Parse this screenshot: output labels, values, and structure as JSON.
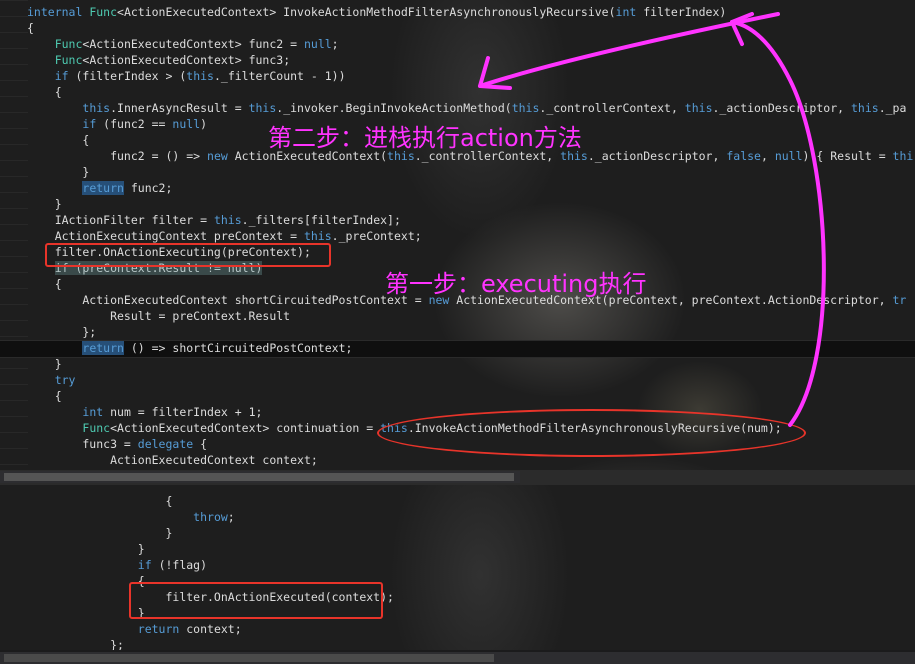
{
  "code_top": [
    [
      {
        "t": "internal ",
        "c": "kw"
      },
      {
        "t": "Func",
        "c": "ty"
      },
      {
        "t": "<ActionExecutedContext> InvokeActionMethodFilterAsynchronouslyRecursive("
      },
      {
        "t": "int",
        "c": "kw"
      },
      {
        "t": " filterIndex)"
      }
    ],
    [
      {
        "t": "{"
      }
    ],
    [
      {
        "t": "    "
      },
      {
        "t": "Func",
        "c": "ty"
      },
      {
        "t": "<ActionExecutedContext> func2 = "
      },
      {
        "t": "null",
        "c": "kw"
      },
      {
        "t": ";"
      }
    ],
    [
      {
        "t": "    "
      },
      {
        "t": "Func",
        "c": "ty"
      },
      {
        "t": "<ActionExecutedContext> func3;"
      }
    ],
    [
      {
        "t": "    "
      },
      {
        "t": "if",
        "c": "kw"
      },
      {
        "t": " (filterIndex > ("
      },
      {
        "t": "this",
        "c": "kw"
      },
      {
        "t": "._filterCount - 1))"
      }
    ],
    [
      {
        "t": "    {"
      }
    ],
    [
      {
        "t": "        "
      },
      {
        "t": "this",
        "c": "kw"
      },
      {
        "t": ".InnerAsyncResult = "
      },
      {
        "t": "this",
        "c": "kw"
      },
      {
        "t": "._invoker.BeginInvokeActionMethod("
      },
      {
        "t": "this",
        "c": "kw"
      },
      {
        "t": "._controllerContext, "
      },
      {
        "t": "this",
        "c": "kw"
      },
      {
        "t": "._actionDescriptor, "
      },
      {
        "t": "this",
        "c": "kw"
      },
      {
        "t": "._pa"
      }
    ],
    [
      {
        "t": "        "
      },
      {
        "t": "if",
        "c": "kw"
      },
      {
        "t": " (func2 == "
      },
      {
        "t": "null",
        "c": "kw"
      },
      {
        "t": ")"
      }
    ],
    [
      {
        "t": "        {"
      }
    ],
    [
      {
        "t": "            func2 = () => "
      },
      {
        "t": "new",
        "c": "kw"
      },
      {
        "t": " ActionExecutedContext("
      },
      {
        "t": "this",
        "c": "kw"
      },
      {
        "t": "._controllerContext, "
      },
      {
        "t": "this",
        "c": "kw"
      },
      {
        "t": "._actionDescriptor, "
      },
      {
        "t": "false",
        "c": "kw"
      },
      {
        "t": ", "
      },
      {
        "t": "null",
        "c": "kw"
      },
      {
        "t": ") { Result = "
      },
      {
        "t": "thi",
        "c": "kw"
      }
    ],
    [
      {
        "t": "        }"
      }
    ],
    [
      {
        "t": "        "
      },
      {
        "t": "return",
        "c": "kw hsel"
      },
      {
        "t": " func2;"
      }
    ],
    [
      {
        "t": "    }"
      }
    ],
    [
      {
        "t": "    IActionFilter filter = "
      },
      {
        "t": "this",
        "c": "kw"
      },
      {
        "t": "._filters[filterIndex];"
      }
    ],
    [
      {
        "t": "    ActionExecutingContext preContext = "
      },
      {
        "t": "this",
        "c": "kw"
      },
      {
        "t": "._preContext;"
      }
    ],
    [
      {
        "t": "    filter.OnActionExecuting(preContext);"
      }
    ],
    [
      {
        "t": "    "
      },
      {
        "t": "if (preContext.Result != null)",
        "c": "hgrey"
      }
    ],
    [
      {
        "t": "    {"
      }
    ],
    [
      {
        "t": "        ActionExecutedContext shortCircuitedPostContext = "
      },
      {
        "t": "new",
        "c": "kw"
      },
      {
        "t": " ActionExecutedContext(preContext, preContext.ActionDescriptor, "
      },
      {
        "t": "tr",
        "c": "kw"
      }
    ],
    [
      {
        "t": "            Result = preContext.Result"
      }
    ],
    [
      {
        "t": "        };"
      }
    ],
    [
      {
        "t": "        "
      },
      {
        "t": "return",
        "c": "kw hsel"
      },
      {
        "t": " () => shortCircuitedPostContext;"
      }
    ],
    [
      {
        "t": "    }"
      }
    ],
    [
      {
        "t": "    "
      },
      {
        "t": "try",
        "c": "kw"
      }
    ],
    [
      {
        "t": "    {"
      }
    ],
    [
      {
        "t": "        "
      },
      {
        "t": "int",
        "c": "kw"
      },
      {
        "t": " num = filterIndex + 1;"
      }
    ],
    [
      {
        "t": "        "
      },
      {
        "t": "Func",
        "c": "ty"
      },
      {
        "t": "<ActionExecutedContext> continuation = "
      },
      {
        "t": "this",
        "c": "kw"
      },
      {
        "t": ".InvokeActionMethodFilterAsynchronouslyRecursive(num);"
      }
    ],
    [
      {
        "t": "        func3 = "
      },
      {
        "t": "delegate",
        "c": "kw"
      },
      {
        "t": " {"
      }
    ],
    [
      {
        "t": "            ActionExecutedContext context;"
      }
    ]
  ],
  "code_bottom": [
    [
      {
        "t": "                    {"
      }
    ],
    [
      {
        "t": "                        "
      },
      {
        "t": "throw",
        "c": "kw"
      },
      {
        "t": ";"
      }
    ],
    [
      {
        "t": "                    }"
      }
    ],
    [
      {
        "t": "                }"
      }
    ],
    [
      {
        "t": "                "
      },
      {
        "t": "if",
        "c": "kw"
      },
      {
        "t": " (!flag)"
      }
    ],
    [
      {
        "t": "                {"
      }
    ],
    [
      {
        "t": "                    filter.OnActionExecuted(context);"
      }
    ],
    [
      {
        "t": "                }"
      }
    ],
    [
      {
        "t": "                "
      },
      {
        "t": "return",
        "c": "kw"
      },
      {
        "t": " context;"
      }
    ],
    [
      {
        "t": "            };"
      }
    ]
  ],
  "annotations": {
    "step2": "第二步：进栈执行action方法",
    "step1": "第一步：executing执行"
  },
  "colors": {
    "annotation": "#ff33ff",
    "box": "#e8342a",
    "keyword": "#569cd6",
    "type": "#4ec9b0"
  }
}
